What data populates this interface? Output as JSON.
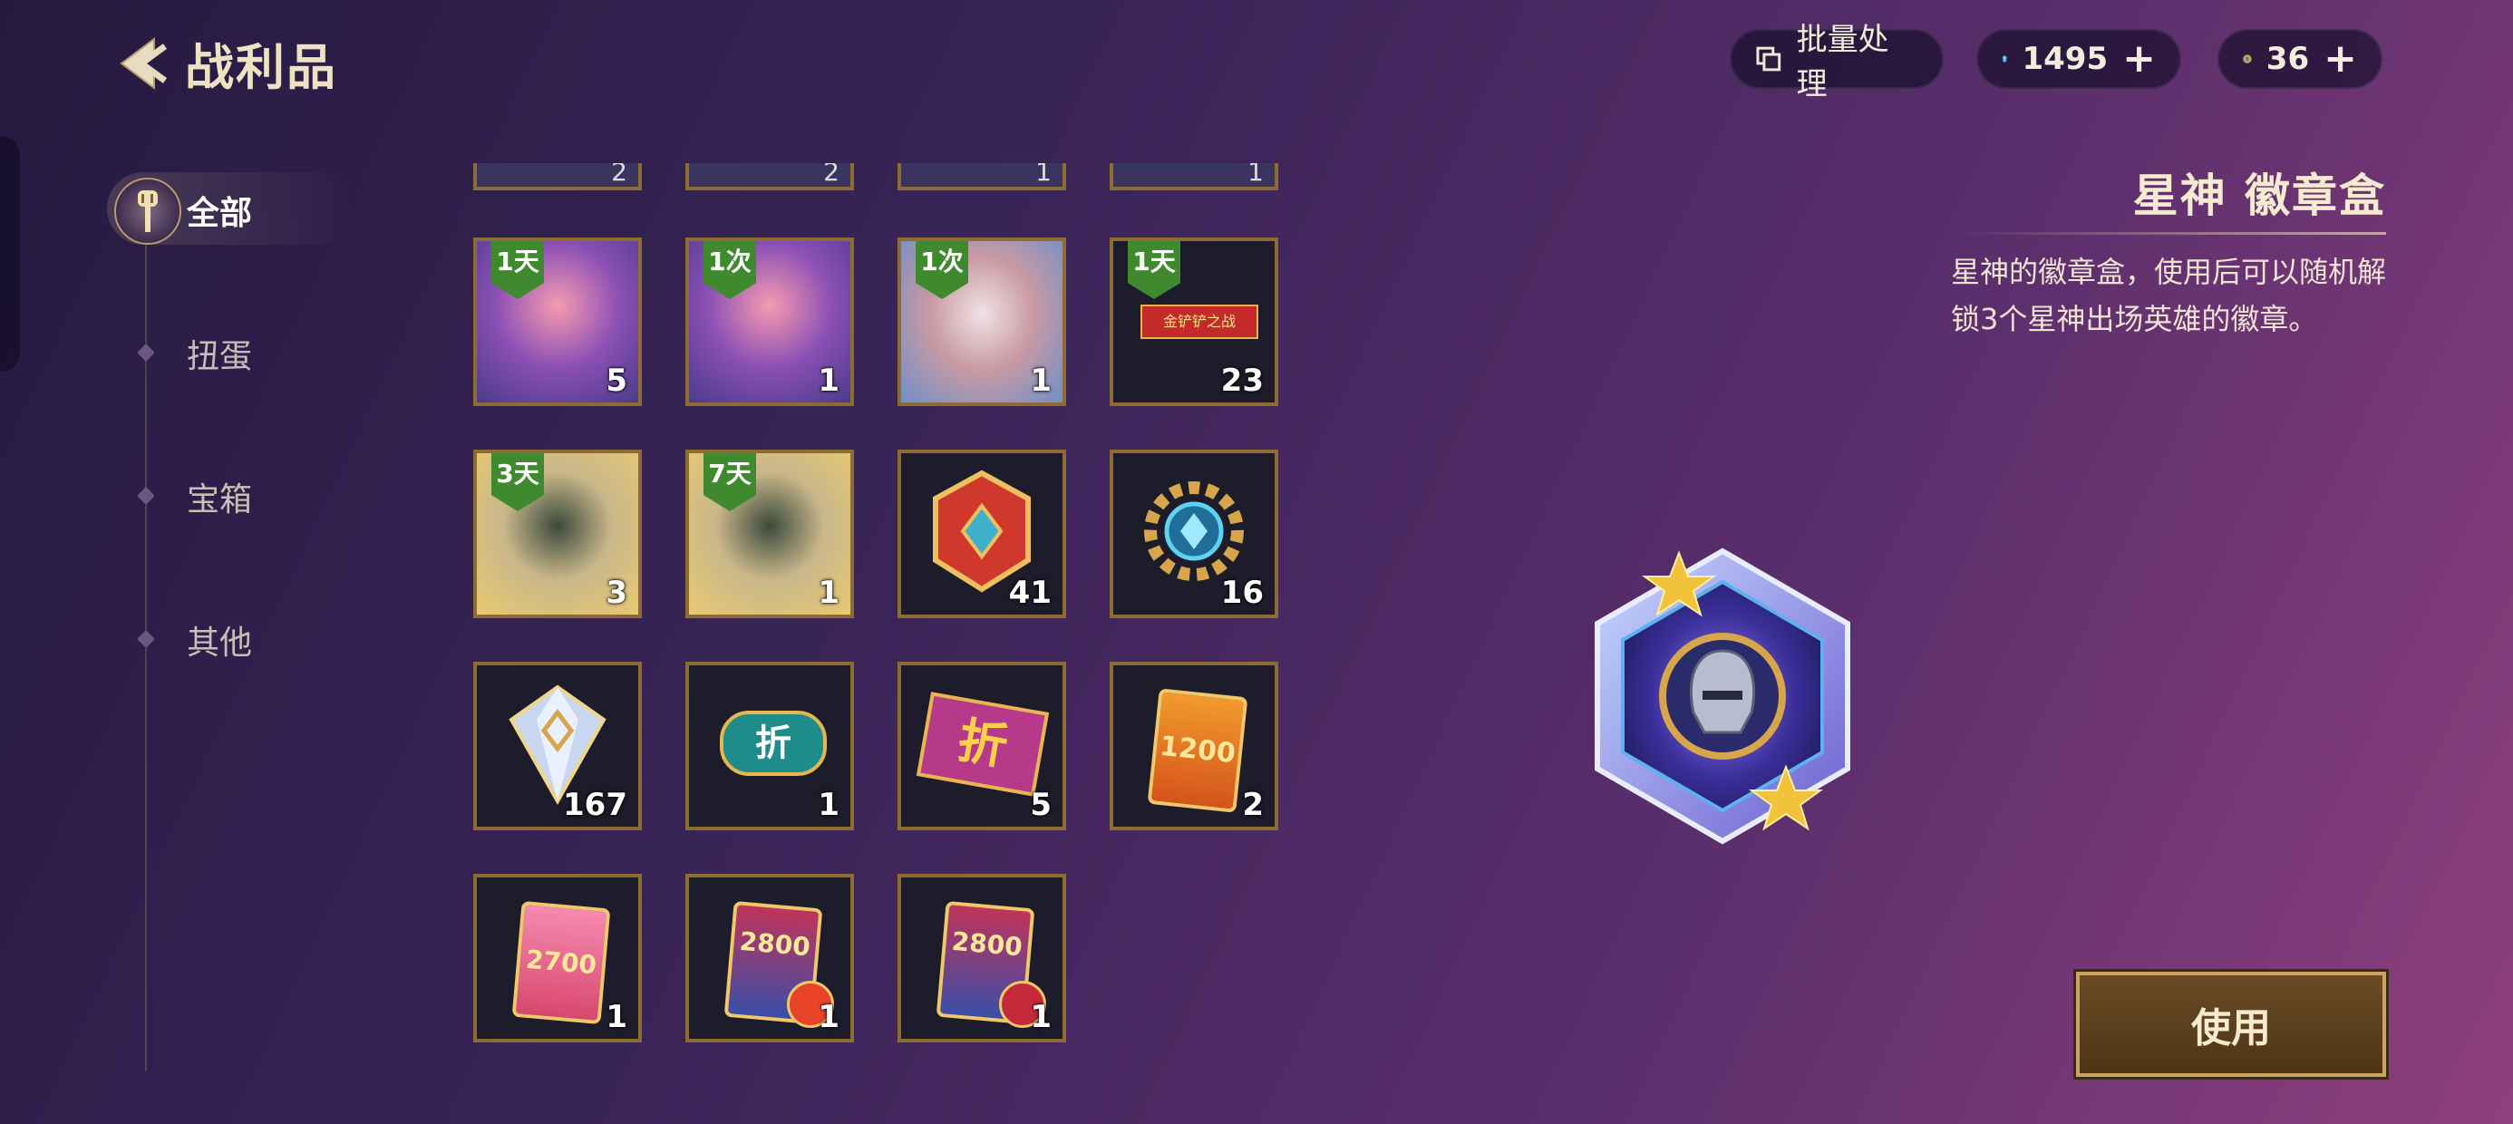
{
  "header": {
    "title": "战利品"
  },
  "topbar": {
    "batch_label": "批量处理",
    "gems": "1495",
    "coins": "36",
    "plus": "+"
  },
  "sidebar": {
    "items": [
      {
        "label": "全部",
        "active": true
      },
      {
        "label": "扭蛋",
        "active": false
      },
      {
        "label": "宝箱",
        "active": false
      },
      {
        "label": "其他",
        "active": false
      }
    ]
  },
  "inventory": {
    "partial_row": [
      "2",
      "2",
      "1",
      "1"
    ],
    "items": [
      {
        "name": "zoe-avatar",
        "badge": "1天",
        "count": "5"
      },
      {
        "name": "zoe-avatar",
        "badge": "1次",
        "count": "1"
      },
      {
        "name": "arena-map",
        "badge": "1次",
        "count": "1"
      },
      {
        "name": "golden-spatula-battle",
        "badge": "1天",
        "banner": "金铲铲之战",
        "count": "23"
      },
      {
        "name": "akali-avatar",
        "badge": "3天",
        "count": "3"
      },
      {
        "name": "akali-avatar",
        "badge": "7天",
        "count": "1"
      },
      {
        "name": "red-emblem",
        "badge": "",
        "count": "41"
      },
      {
        "name": "gear-emblem",
        "badge": "",
        "count": "16"
      },
      {
        "name": "crystal-gem",
        "badge": "",
        "count": "167"
      },
      {
        "name": "discount-ticket-teal",
        "badge": "",
        "text": "折",
        "count": "1"
      },
      {
        "name": "discount-ticket-purple",
        "badge": "",
        "text": "折",
        "count": "5"
      },
      {
        "name": "card-1200",
        "badge": "",
        "text": "1200",
        "count": "2"
      },
      {
        "name": "card-2700",
        "badge": "",
        "text": "2700",
        "count": "1"
      },
      {
        "name": "card-2800-fire",
        "badge": "",
        "text": "2800",
        "count": "1"
      },
      {
        "name": "card-2800-red",
        "badge": "",
        "text": "2800",
        "count": "1"
      }
    ]
  },
  "detail": {
    "title": "星神  徽章盒",
    "description": "星神的徽章盒，使用后可以随机解锁3个星神出场英雄的徽章。",
    "use_button": "使用"
  },
  "colors": {
    "tile_border": "#8c6c33",
    "badge_green": "#3f8a2e",
    "button_gold": "#c9a463"
  }
}
